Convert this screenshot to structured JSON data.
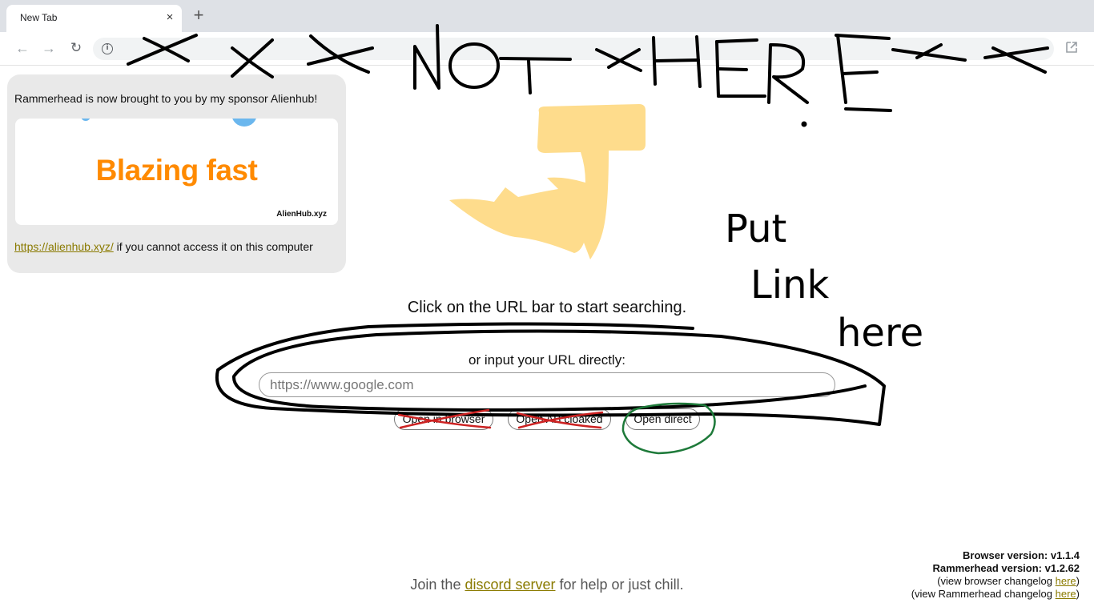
{
  "browser": {
    "tab_title": "New Tab",
    "tab_close_glyph": "×",
    "new_tab_glyph": "+",
    "back_glyph": "←",
    "forward_glyph": "→",
    "reload_glyph": "↻",
    "info_glyph": "i"
  },
  "sponsor": {
    "intro": "Rammerhead is now brought to you by my sponsor Alienhub!",
    "banner_headline": "Blazing fast",
    "banner_brand": "AlienHub.xyz",
    "link_text": "https://alienhub.xyz/",
    "after_link": " if you cannot access it on this computer"
  },
  "main": {
    "hint": "Click on the URL bar to start searching.",
    "sub_hint": "or input your URL directly:",
    "url_placeholder": "https://www.google.com",
    "buttons": {
      "open_in_browser": "Open in browser",
      "open_ab_cloaked": "Open AB cloaked",
      "open_direct": "Open direct"
    }
  },
  "footer": {
    "join_prefix": "Join the ",
    "discord_link": "discord server",
    "join_suffix": " for help or just chill.",
    "browser_version": "Browser version: v1.1.4",
    "rammerhead_version": "Rammerhead version: v1.2.62",
    "browser_changelog_prefix": "(view browser changelog ",
    "rammerhead_changelog_prefix": "(view Rammerhead changelog ",
    "here_link": "here",
    "closing_paren": ")"
  },
  "annotations": {
    "header_scribble": "X X X Not XHERE XX",
    "put": "Put",
    "link": "Link",
    "here": "here",
    "ink_color": "#000000",
    "strike_color": "#cc2222",
    "circle_color": "#1e7a3a"
  },
  "colors": {
    "accent_link": "#8a7a00",
    "banner_orange": "#ff8a00",
    "logo_fill": "#fedc8c"
  }
}
